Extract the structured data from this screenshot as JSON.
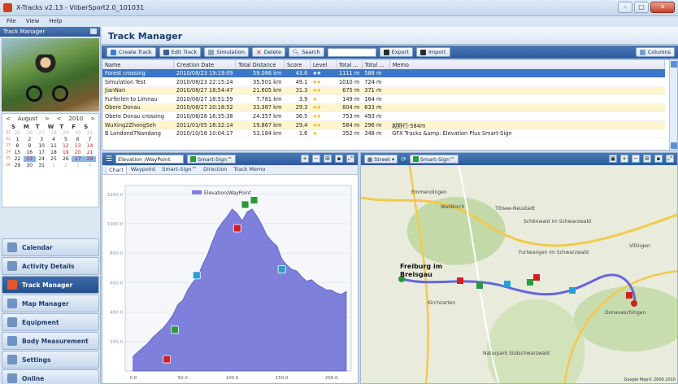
{
  "window": {
    "title": "X-Tracks v2.13 - ViiberSport2.0_101031"
  },
  "menu": [
    "File",
    "View",
    "Help"
  ],
  "sidebar": {
    "header": "Track Manager",
    "calendar": {
      "month": "August",
      "year": "2010",
      "prev": "<",
      "next": ">",
      "dow": [
        "S",
        "M",
        "T",
        "W",
        "T",
        "F",
        "S"
      ],
      "weeks": [
        {
          "wk": "31",
          "days": [
            "25",
            "26",
            "27",
            "28",
            "29",
            "30",
            "31"
          ]
        },
        {
          "wk": "32",
          "days": [
            "1",
            "2",
            "3",
            "4",
            "5",
            "6",
            "7"
          ]
        },
        {
          "wk": "33",
          "days": [
            "8",
            "9",
            "10",
            "11",
            "12",
            "13",
            "14"
          ]
        },
        {
          "wk": "34",
          "days": [
            "15",
            "16",
            "17",
            "18",
            "19",
            "20",
            "21"
          ]
        },
        {
          "wk": "35",
          "days": [
            "22",
            "23",
            "24",
            "25",
            "26",
            "27",
            "28"
          ]
        },
        {
          "wk": "36",
          "days": [
            "29",
            "30",
            "31",
            "1",
            "2",
            "3",
            "4"
          ]
        }
      ]
    },
    "nav": [
      {
        "label": "Calendar",
        "name": "nav-calendar"
      },
      {
        "label": "Activity Details",
        "name": "nav-activity-details"
      },
      {
        "label": "Track Manager",
        "name": "nav-track-manager"
      },
      {
        "label": "Map Manager",
        "name": "nav-map-manager"
      },
      {
        "label": "Equipment",
        "name": "nav-equipment"
      },
      {
        "label": "Body Measurement",
        "name": "nav-body-measurement"
      },
      {
        "label": "Settings",
        "name": "nav-settings"
      },
      {
        "label": "Online",
        "name": "nav-online"
      }
    ]
  },
  "main": {
    "title": "Track Manager",
    "toolbar": {
      "create": "Create Track",
      "edit": "Edit Track",
      "simulation": "Simulation",
      "delete": "Delete",
      "search": "Search",
      "export": "Export",
      "import": "Import",
      "columns": "Columns"
    },
    "table": {
      "headers": [
        "Name",
        "Creation Date",
        "Total Distance",
        "Score",
        "Level",
        "Total ...",
        "Total ...",
        "Memo"
      ],
      "rows": [
        [
          "Forest crossing",
          "2010/08/23 19:19:09",
          "59.086 km",
          "43.6",
          "★★",
          "1111 m",
          "588 m",
          ""
        ],
        [
          "Simulation Test",
          "2010/08/23 22:15:24",
          "35.501 km",
          "49.1",
          "★★",
          "1010 m",
          "724 m",
          ""
        ],
        [
          "JianNan",
          "2010/08/27 18:54:47",
          "21.605 km",
          "31.3",
          "★★",
          "675 m",
          "371 m",
          ""
        ],
        [
          "Furferlen to Limnau",
          "2010/08/27 18:51:59",
          "7.781 km",
          "3.9",
          "★",
          "149 m",
          "164 m",
          ""
        ],
        [
          "Obere Donau",
          "2010/08/27 20:18:52",
          "33.387 km",
          "29.3",
          "★★",
          "804 m",
          "633 m",
          ""
        ],
        [
          "Obere Donau crossing",
          "2010/08/28 16:35:38",
          "24.357 km",
          "36.5",
          "★★",
          "753 m",
          "493 m",
          ""
        ],
        [
          "WuXing2ZhongSeh",
          "2011/01/05 18:32:14",
          "19.867 km",
          "29.4",
          "★★",
          "584 m",
          "296 m",
          "越野行-584m"
        ],
        [
          "B Londond7Nandang",
          "2010/10/18 10:04:17",
          "53.184 km",
          "1.6",
          "★",
          "352 m",
          "348 m",
          "GFX Tracks &amp: Elevation Plus Smart-Sign"
        ]
      ]
    }
  },
  "chart_panel": {
    "select_value": "Elevation /WayPoint",
    "smart_sign": "Smart-Sign™",
    "tabs": [
      "Chart",
      "Waypoint",
      "Smart-Sign™",
      "Direction",
      "Track Memo"
    ]
  },
  "chart_data": {
    "type": "area",
    "legend": "Elevation/WayPoint",
    "xlim": [
      -8,
      220
    ],
    "ylim": [
      0,
      1260
    ],
    "xticks": [
      "0.0",
      "50.0",
      "100.0",
      "150.0",
      "200.0"
    ],
    "yticks": [
      "200.0",
      "400.0",
      "600.0",
      "800.0",
      "1000.0",
      "1200.0"
    ],
    "ytick_values": [
      200,
      400,
      600,
      800,
      1000,
      1200
    ],
    "xtick_values": [
      0,
      50,
      100,
      150,
      200
    ],
    "x": [
      0,
      5,
      10,
      15,
      20,
      25,
      30,
      35,
      40,
      45,
      50,
      55,
      60,
      65,
      70,
      75,
      80,
      85,
      90,
      95,
      100,
      105,
      110,
      115,
      120,
      125,
      130,
      135,
      140,
      145,
      150,
      155,
      160,
      165,
      170,
      175,
      180,
      185,
      190,
      195,
      200,
      205,
      210,
      215
    ],
    "y": [
      100,
      130,
      160,
      190,
      230,
      260,
      290,
      330,
      380,
      450,
      480,
      550,
      600,
      640,
      720,
      790,
      880,
      960,
      1010,
      1050,
      1100,
      1070,
      1020,
      1080,
      1100,
      1050,
      990,
      920,
      880,
      850,
      760,
      720,
      690,
      680,
      640,
      610,
      620,
      590,
      570,
      550,
      550,
      530,
      520,
      540
    ],
    "color": "#7f7fdc",
    "waypoints": [
      {
        "x": 42,
        "y": 280,
        "kind": "green"
      },
      {
        "x": 64,
        "y": 650,
        "kind": "cyan"
      },
      {
        "x": 105,
        "y": 970,
        "kind": "red"
      },
      {
        "x": 113,
        "y": 1130,
        "kind": "green"
      },
      {
        "x": 122,
        "y": 1160,
        "kind": "green"
      },
      {
        "x": 150,
        "y": 690,
        "kind": "cyan"
      },
      {
        "x": 34,
        "y": 80,
        "kind": "red"
      }
    ]
  },
  "map_panel": {
    "street": "Street",
    "smart_sign": "Smart-Sign™",
    "labels": {
      "freiburg": "Freiburg im Breisgau",
      "copyright": "Google Map© 2009 2010",
      "emmendingen": "Emmendingen",
      "titisee": "Titisee-Neustadt",
      "villingen": "Villingen",
      "schonwald": "Schönwald im Schwarzwald",
      "furtwangen": "Furtwangen im Schwarzwald",
      "donaueschingen": "Donaueschingen",
      "kirchzarten": "Kirchzarten",
      "waldkirch": "Waldkirch",
      "naturpark": "Naturpark Südschwarzwald"
    }
  },
  "colors": {
    "accent": "#2d5a99",
    "selected_row": "#3a77c9",
    "alt_row": "#fff5cf",
    "track": "#6666dd"
  }
}
